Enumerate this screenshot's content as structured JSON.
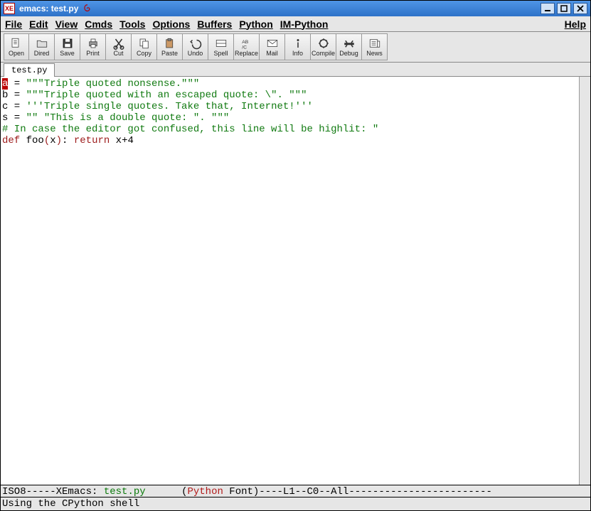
{
  "window": {
    "app_icon_text": "XE",
    "title": "emacs: test.py"
  },
  "menubar": {
    "file": "File",
    "edit": "Edit",
    "view": "View",
    "cmds": "Cmds",
    "tools": "Tools",
    "options": "Options",
    "buffers": "Buffers",
    "python": "Python",
    "impython": "IM-Python",
    "help": "Help"
  },
  "toolbar": [
    {
      "name": "open",
      "label": "Open",
      "icon": "open-icon"
    },
    {
      "name": "dired",
      "label": "Dired",
      "icon": "folder-icon"
    },
    {
      "name": "save",
      "label": "Save",
      "icon": "save-icon"
    },
    {
      "name": "print",
      "label": "Print",
      "icon": "print-icon"
    },
    {
      "name": "cut",
      "label": "Cut",
      "icon": "cut-icon"
    },
    {
      "name": "copy",
      "label": "Copy",
      "icon": "copy-icon"
    },
    {
      "name": "paste",
      "label": "Paste",
      "icon": "paste-icon"
    },
    {
      "name": "undo",
      "label": "Undo",
      "icon": "undo-icon"
    },
    {
      "name": "spell",
      "label": "Spell",
      "icon": "spell-icon"
    },
    {
      "name": "replace",
      "label": "Replace",
      "icon": "replace-icon"
    },
    {
      "name": "mail",
      "label": "Mail",
      "icon": "mail-icon"
    },
    {
      "name": "info",
      "label": "Info",
      "icon": "info-icon"
    },
    {
      "name": "compile",
      "label": "Compile",
      "icon": "compile-icon"
    },
    {
      "name": "debug",
      "label": "Debug",
      "icon": "debug-icon"
    },
    {
      "name": "news",
      "label": "News",
      "icon": "news-icon"
    }
  ],
  "tabs": {
    "active": "test.py"
  },
  "code": {
    "l1_cursor": "a",
    "l1_rest": " = ",
    "l1_str": "\"\"\"Triple quoted nonsense.\"\"\"",
    "l2_pre": "b = ",
    "l2_str": "\"\"\"Triple quoted with an escaped quote: \\\". \"\"\"",
    "l3_pre": "c = ",
    "l3_str": "'''Triple single quotes. Take that, Internet!'''",
    "l4_pre": "s = ",
    "l4_str": "\"\" \"This is a double quote: \". \"\"\"",
    "l5_cmt": "# In case the editor got confused, this line will be highlit: \"",
    "l6_kw": "def",
    "l6_mid1": " foo",
    "l6_paren1": "(",
    "l6_arg": "x",
    "l6_paren2": ")",
    "l6_mid2": ": ",
    "l6_kw2": "return",
    "l6_tail": " x+4"
  },
  "modeline": {
    "pre": "ISO8-----",
    "app": "XEmacs: ",
    "file": "test.py",
    "gap": "      (",
    "mode": "Python",
    "mode2": " Font",
    "post": ")----L1--C0--All------------------------"
  },
  "minibuffer": "Using the CPython shell"
}
